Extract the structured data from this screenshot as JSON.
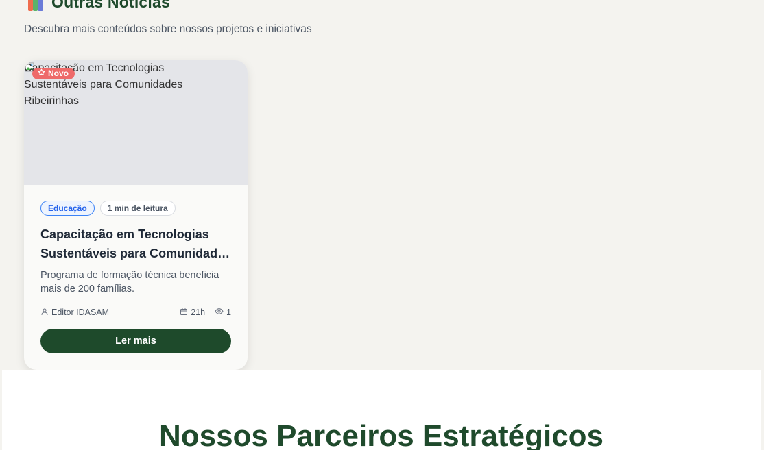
{
  "section": {
    "title": "Outras Notícias",
    "subtitle": "Descubra mais conteúdos sobre nossos projetos e iniciativas",
    "icon": "books-icon"
  },
  "card": {
    "image_alt": "Capacitação em Tecnologias Sustentáveis para Comunidades Ribeirinhas",
    "badge": "Novo",
    "category": "Educação",
    "read_time": "1 min de leitura",
    "title": "Capacitação em Tecnologias Sustentáveis para Comunidades Ribeirinhas",
    "excerpt": "Programa de formação técnica beneficia mais de 200 famílias.",
    "author": "Editor IDASAM",
    "date": "21h",
    "views": "1",
    "button_label": "Ler mais"
  },
  "partners": {
    "title": "Nossos Parceiros Estratégicos"
  },
  "colors": {
    "brand_green": "#1e4a2b",
    "badge_red": "#ee6a6a",
    "category_blue": "#2563eb",
    "page_bg": "#f4f3ef"
  }
}
